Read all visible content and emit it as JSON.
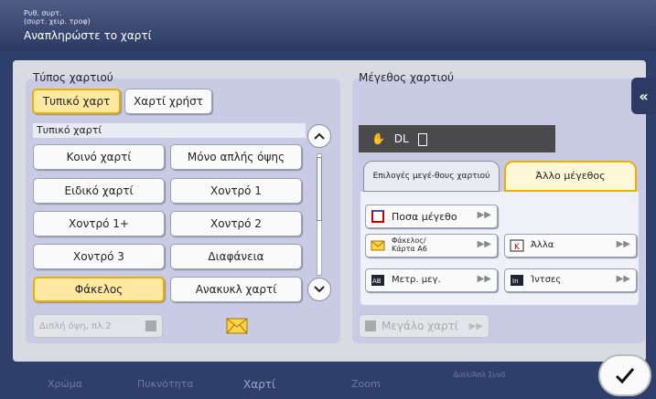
{
  "header": {
    "subtitle_line1": "Ρυθ. συρτ.",
    "subtitle_line2": "(συρτ. χειρ. τροφ)",
    "title": "Αναπληρώστε το χαρτί"
  },
  "paper_type": {
    "heading": "Τύπος χαρτιού",
    "mode_buttons": [
      "Τυπικό χαρτ",
      "Χαρτί χρήστ"
    ],
    "selected_mode": "Τυπικό χαρτ",
    "list_header": "Τυπικό χαρτί",
    "items": [
      "Κοινό χαρτί",
      "Μόνο απλής όψης",
      "Ειδικό χαρτί",
      "Χοντρό 1",
      "Χοντρό 1+",
      "Χοντρό 2",
      "Χοντρό 3",
      "Διαφάνεια",
      "Φάκελος",
      "Ανακυκλ χαρτί"
    ],
    "selected_item": "Φάκελος",
    "duplex_label": "Διπλή όψη, πλ.2",
    "envelope_icon": "envelope-icon"
  },
  "paper_size": {
    "heading": "Μέγεθος χαρτιού",
    "current": "DL",
    "tabs": [
      "Επιλογές μεγέ-θους χαρτιού",
      "Άλλο μέγεθος"
    ],
    "selected_tab": "Άλλο μέγεθος",
    "options": [
      "Ποσα μέγεθο",
      "Φάκελος/ Κάρτα Α6",
      "Άλλα",
      "Μετρ. μεγ.",
      "Ίντσες"
    ],
    "large_paper": "Μεγάλο χαρτί"
  },
  "bottom_tabs": [
    "Χρώμα",
    "Πυκνότητα",
    "Χαρτί",
    "Zoom",
    "Διπλ/Απλ Συνδ"
  ],
  "active_bottom_tab": "Χαρτί",
  "colors": {
    "accent": "#e8b000",
    "header": "#2f3f6b"
  }
}
